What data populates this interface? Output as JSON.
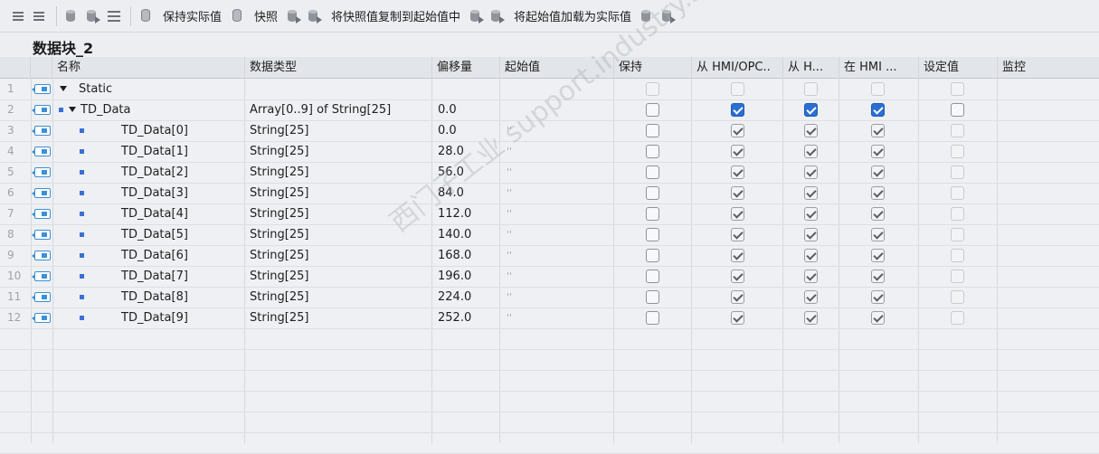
{
  "toolbar": {
    "keep_actual_label": "保持实际值",
    "snapshot_label": "快照",
    "copy_snapshot_label": "将快照值复制到起始值中",
    "load_start_label": "将起始值加载为实际值"
  },
  "block": {
    "title": "数据块_2"
  },
  "columns": [
    "名称",
    "数据类型",
    "偏移量",
    "起始值",
    "保持",
    "从 HMI/OPC..",
    "从 H...",
    "在 HMI ...",
    "设定值",
    "监控"
  ],
  "rows": [
    {
      "num": "1",
      "name": "Static",
      "type": "",
      "offset": "",
      "start": "",
      "retain": "light",
      "hmi_opc": "light",
      "from_h": "light",
      "in_hmi": "light",
      "setpoint": "light",
      "expand": true,
      "square": false,
      "indent": 0
    },
    {
      "num": "2",
      "name": "TD_Data",
      "type": "Array[0..9] of String[25]",
      "offset": "0.0",
      "start": "",
      "retain": "off",
      "hmi_opc": "blue",
      "from_h": "blue",
      "in_hmi": "blue",
      "setpoint": "off",
      "expand": true,
      "square": true,
      "indent": 1
    },
    {
      "num": "3",
      "name": "TD_Data[0]",
      "type": "String[25]",
      "offset": "0.0",
      "start": "''",
      "retain": "off",
      "hmi_opc": "gray",
      "from_h": "gray",
      "in_hmi": "gray",
      "setpoint": "light",
      "expand": false,
      "square": true,
      "indent": 2
    },
    {
      "num": "4",
      "name": "TD_Data[1]",
      "type": "String[25]",
      "offset": "28.0",
      "start": "''",
      "retain": "off",
      "hmi_opc": "gray",
      "from_h": "gray",
      "in_hmi": "gray",
      "setpoint": "light",
      "expand": false,
      "square": true,
      "indent": 2
    },
    {
      "num": "5",
      "name": "TD_Data[2]",
      "type": "String[25]",
      "offset": "56.0",
      "start": "''",
      "retain": "off",
      "hmi_opc": "gray",
      "from_h": "gray",
      "in_hmi": "gray",
      "setpoint": "light",
      "expand": false,
      "square": true,
      "indent": 2
    },
    {
      "num": "6",
      "name": "TD_Data[3]",
      "type": "String[25]",
      "offset": "84.0",
      "start": "''",
      "retain": "off",
      "hmi_opc": "gray",
      "from_h": "gray",
      "in_hmi": "gray",
      "setpoint": "light",
      "expand": false,
      "square": true,
      "indent": 2
    },
    {
      "num": "7",
      "name": "TD_Data[4]",
      "type": "String[25]",
      "offset": "112.0",
      "start": "''",
      "retain": "off",
      "hmi_opc": "gray",
      "from_h": "gray",
      "in_hmi": "gray",
      "setpoint": "light",
      "expand": false,
      "square": true,
      "indent": 2
    },
    {
      "num": "8",
      "name": "TD_Data[5]",
      "type": "String[25]",
      "offset": "140.0",
      "start": "''",
      "retain": "off",
      "hmi_opc": "gray",
      "from_h": "gray",
      "in_hmi": "gray",
      "setpoint": "light",
      "expand": false,
      "square": true,
      "indent": 2
    },
    {
      "num": "9",
      "name": "TD_Data[6]",
      "type": "String[25]",
      "offset": "168.0",
      "start": "''",
      "retain": "off",
      "hmi_opc": "gray",
      "from_h": "gray",
      "in_hmi": "gray",
      "setpoint": "light",
      "expand": false,
      "square": true,
      "indent": 2
    },
    {
      "num": "10",
      "name": "TD_Data[7]",
      "type": "String[25]",
      "offset": "196.0",
      "start": "''",
      "retain": "off",
      "hmi_opc": "gray",
      "from_h": "gray",
      "in_hmi": "gray",
      "setpoint": "light",
      "expand": false,
      "square": true,
      "indent": 2
    },
    {
      "num": "11",
      "name": "TD_Data[8]",
      "type": "String[25]",
      "offset": "224.0",
      "start": "''",
      "retain": "off",
      "hmi_opc": "gray",
      "from_h": "gray",
      "in_hmi": "gray",
      "setpoint": "light",
      "expand": false,
      "square": true,
      "indent": 2
    },
    {
      "num": "12",
      "name": "TD_Data[9]",
      "type": "String[25]",
      "offset": "252.0",
      "start": "''",
      "retain": "off",
      "hmi_opc": "gray",
      "from_h": "gray",
      "in_hmi": "gray",
      "setpoint": "light",
      "expand": false,
      "square": true,
      "indent": 2
    }
  ],
  "watermark": "西门子工业 support.industry.siemens.com/cs 找答案",
  "colors": {
    "accent": "#2a6fd1",
    "icon_blue": "#3c8fd6"
  }
}
